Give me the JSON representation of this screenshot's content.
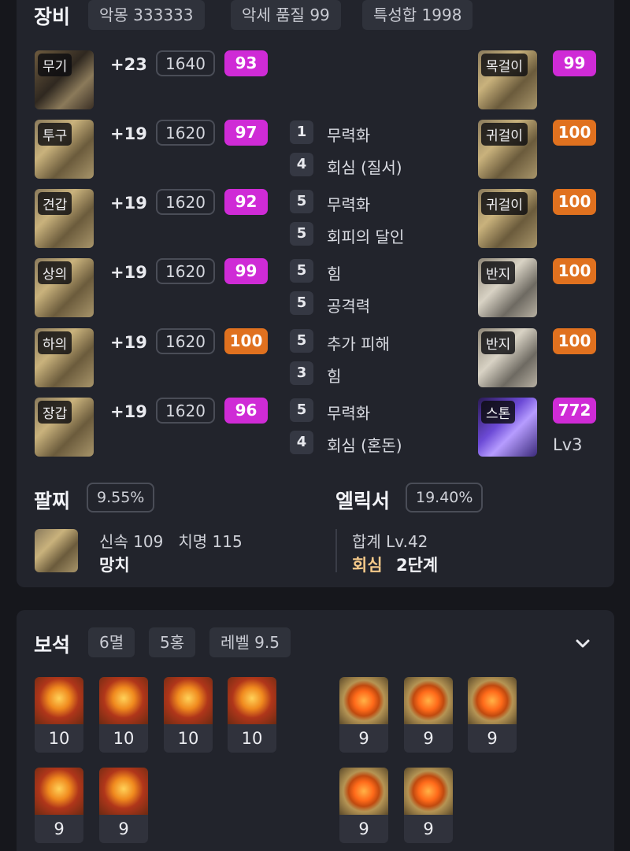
{
  "equipment": {
    "title": "장비",
    "tags": [
      "악몽 333333",
      "악세 품질 99",
      "특성합 1998"
    ],
    "armor": [
      {
        "slot": "무기",
        "level": "+23",
        "item_level": "1640",
        "quality": "93",
        "quality_color": "#cf2bd6",
        "engravings": []
      },
      {
        "slot": "투구",
        "level": "+19",
        "item_level": "1620",
        "quality": "97",
        "quality_color": "#cf2bd6",
        "engravings": [
          {
            "num": "1",
            "name": "무력화"
          },
          {
            "num": "4",
            "name": "회심 (질서)"
          }
        ]
      },
      {
        "slot": "견갑",
        "level": "+19",
        "item_level": "1620",
        "quality": "92",
        "quality_color": "#cf2bd6",
        "engravings": [
          {
            "num": "5",
            "name": "무력화"
          },
          {
            "num": "5",
            "name": "회피의 달인"
          }
        ]
      },
      {
        "slot": "상의",
        "level": "+19",
        "item_level": "1620",
        "quality": "99",
        "quality_color": "#cf2bd6",
        "engravings": [
          {
            "num": "5",
            "name": "힘"
          },
          {
            "num": "5",
            "name": "공격력"
          }
        ]
      },
      {
        "slot": "하의",
        "level": "+19",
        "item_level": "1620",
        "quality": "100",
        "quality_color": "#e0711f",
        "engravings": [
          {
            "num": "5",
            "name": "추가 피해"
          },
          {
            "num": "3",
            "name": "힘"
          }
        ]
      },
      {
        "slot": "장갑",
        "level": "+19",
        "item_level": "1620",
        "quality": "96",
        "quality_color": "#cf2bd6",
        "engravings": [
          {
            "num": "5",
            "name": "무력화"
          },
          {
            "num": "4",
            "name": "회심 (혼돈)"
          }
        ]
      }
    ],
    "accessories": [
      {
        "slot": "목걸이",
        "quality": "99",
        "quality_color": "#cf2bd6"
      },
      {
        "slot": "귀걸이",
        "quality": "100",
        "quality_color": "#e0711f"
      },
      {
        "slot": "귀걸이",
        "quality": "100",
        "quality_color": "#e0711f"
      },
      {
        "slot": "반지",
        "quality": "100",
        "quality_color": "#e0711f"
      },
      {
        "slot": "반지",
        "quality": "100",
        "quality_color": "#e0711f"
      },
      {
        "slot": "스톤",
        "quality": "772",
        "quality_color": "#cf2bd6",
        "sub": "Lv3"
      }
    ],
    "bracelet": {
      "title": "팔찌",
      "percent": "9.55%",
      "stats": "신속 109   치명 115",
      "effect": "망치"
    },
    "elixir": {
      "title": "엘릭서",
      "percent": "19.40%",
      "total": "합계 Lv.42",
      "effect_name": "회심",
      "effect_level": "2단계"
    }
  },
  "gems": {
    "title": "보석",
    "tags": [
      "6멸",
      "5홍",
      "레벨 9.5"
    ],
    "expand_icon": "chevron-down-icon",
    "damage_gems": [
      "10",
      "10",
      "10",
      "10",
      "9",
      "9"
    ],
    "cooldown_gems": [
      "9",
      "9",
      "9",
      "9",
      "9"
    ]
  }
}
